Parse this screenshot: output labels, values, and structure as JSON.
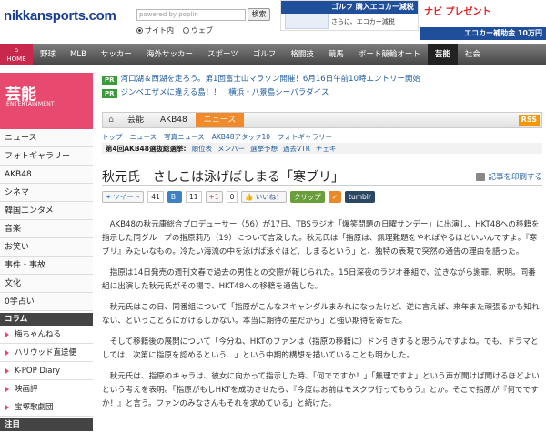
{
  "header": {
    "logo": "nikkansports.com",
    "search_placeholder": "powered by poplin",
    "search_button": "検索",
    "radio_site": "サイト内",
    "radio_web": "ウェブ",
    "ad_left_title": "ゴルフ 購入エコカー減税実施中!",
    "ad_left_sub": "さらに、エコカー減税",
    "ad_right_title": "ナビ プレゼント",
    "ad_right_bar": "エコカー補助金 10万円"
  },
  "nav": {
    "home": "HOME",
    "items": [
      "野球",
      "MLB",
      "サッカー",
      "海外サッカー",
      "スポーツ",
      "ゴルフ",
      "格闘技",
      "競馬",
      "ボート競輪オート",
      "芸能",
      "社会"
    ],
    "active_index": 9
  },
  "sidebar": {
    "title": "芸能",
    "subtitle": "ENTERTAINMENT",
    "items": [
      "ニュース",
      "フォトギャラリー",
      "AKB48",
      "シネマ",
      "韓国エンタメ",
      "音楽",
      "お笑い",
      "事件・事故",
      "文化",
      "0学占い"
    ],
    "column_label": "コラム",
    "column_items": [
      "梅ちゃんねる",
      "ハリウッド直送便",
      "K-POP Diary",
      "映画評",
      "宝塚歌劇団"
    ],
    "bottom_label": "注目"
  },
  "pr": [
    {
      "tag": "PR",
      "text": "河口湖＆西湖を走ろう。第1回富士山マラソン開催！6月16日午前10時エントリー開始"
    },
    {
      "tag": "PR",
      "text": "ジンベエザメに逢える島！！　横浜・八景島シーパラダイス"
    }
  ],
  "breadcrumb": {
    "items": [
      "トップ",
      "芸能",
      "AKB48",
      "ニュース"
    ],
    "rss": "RSS"
  },
  "sublinks": [
    "トップ",
    "ニュース",
    "写真ニュース",
    "AKB48アタック10",
    "フォトギャラリー"
  ],
  "subbox": {
    "label": "第4回AKB48選抜総選挙:",
    "links": [
      "順位表",
      "メンバー",
      "選挙予想",
      "過去VTR",
      "チェキ"
    ]
  },
  "article": {
    "title": "秋元氏　さしこは泳げばしまる「寒ブリ」",
    "print": "記事を印刷する",
    "social": {
      "tweet": "ツイート",
      "tweet_count": "41",
      "hatena_count": "11",
      "gplus": "+1",
      "gplus_count": "0",
      "like": "いいね！",
      "clip": "クリップ",
      "tumblr": "tumblr"
    },
    "paragraphs": [
      "AKB48の秋元康総合プロデューサー（56）が17日、TBSラジオ「爆笑問題の日曜サンデー」に出演し、HKT48への移籍を指示した同グループの指原莉乃（19）について言及した。秋元氏は「指原は、無理難題をやればやるほどいいんですよ。『寒ブリ』みたいなもの。冷たい海流の中を泳げば泳ぐほど、しまるという」と、独特の表現で突然の通告の理由を語った。",
      "指原は14日発売の週刊文春で過去の男性との交際が報じられた。15日深夜のラジオ番組で、泣きながら謝罪、釈明。同番組に出演した秋元氏がその場で、HKT48への移籍を通告した。",
      "秋元氏はこの日、同番組について「指原がこんなスキャンダルまみれになったけど、逆に言えば、来年また頑張るかも知れない、ということろにかけるしかない。本当に期待の星だから」と強い期待を寄せた。",
      "そして移籍後の展開について「今分ね、HKTのファンは（指原の移籍に）ドン引きすると思うんですよね。でも、ドラマとしては、次第に指原を認めるという…」という中期的構想を描いていることも明かした。",
      "秋元氏は、指原のキャラは、彼女に向かって指示した時、「何でですか！」「無理ですよ」という声が聞けば聞けるほどよいという考えを表明。「指原がもしHKTを成功させたら、『今度はお前はモスクワ行ってもらう』とか。そこで指原が『何でですか！』と言う。ファンのみなさんもそれを求めている」と続けた。"
    ]
  }
}
